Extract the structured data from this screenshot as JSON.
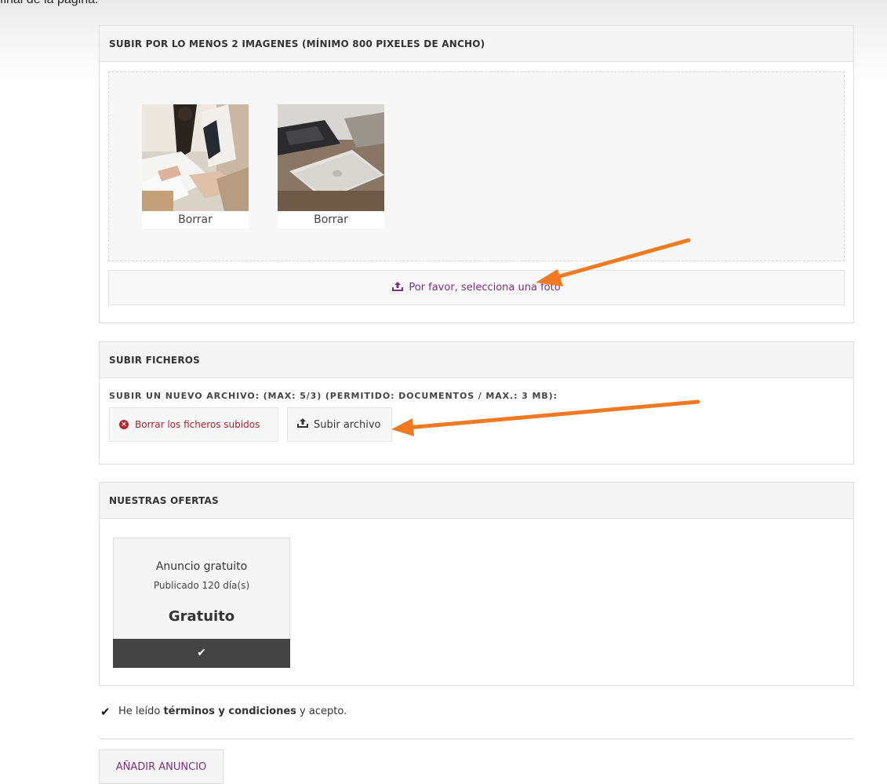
{
  "header_text": "final de la página.",
  "images_panel": {
    "title": "SUBIR POR LO MENOS 2 IMAGENES (MÍNIMO 800 PIXELES DE ANCHO)",
    "thumbs": [
      {
        "delete_label": "Borrar",
        "image": "office-meeting-photo"
      },
      {
        "delete_label": "Borrar",
        "image": "laptop-desk-photo"
      }
    ],
    "select_label": "Por favor, selecciona una foto",
    "select_icon": "upload-icon"
  },
  "files_panel": {
    "title": "SUBIR FICHEROS",
    "upload_info": "SUBIR UN NUEVO ARCHIVO: (MAX: 5/3) (PERMITIDO: DOCUMENTOS / MAX.: 3 MB):",
    "delete_label": "Borrar los ficheros subidos",
    "upload_label": "Subir archivo"
  },
  "offers_panel": {
    "title": "NUESTRAS OFERTAS",
    "offer": {
      "name": "Anuncio gratuito",
      "duration": "Publicado 120 día(s)",
      "price": "Gratuito",
      "selected_icon": "check-icon"
    }
  },
  "terms": {
    "prefix": "He leído ",
    "link": "términos y condiciones",
    "suffix": " y acepto.",
    "checked": true
  },
  "submit_label": "AÑADIR ANUNCIO",
  "colors": {
    "accent": "#7b2f83",
    "danger": "#b3282d",
    "arrow": "#f07a22",
    "offer_bar": "#444444"
  }
}
